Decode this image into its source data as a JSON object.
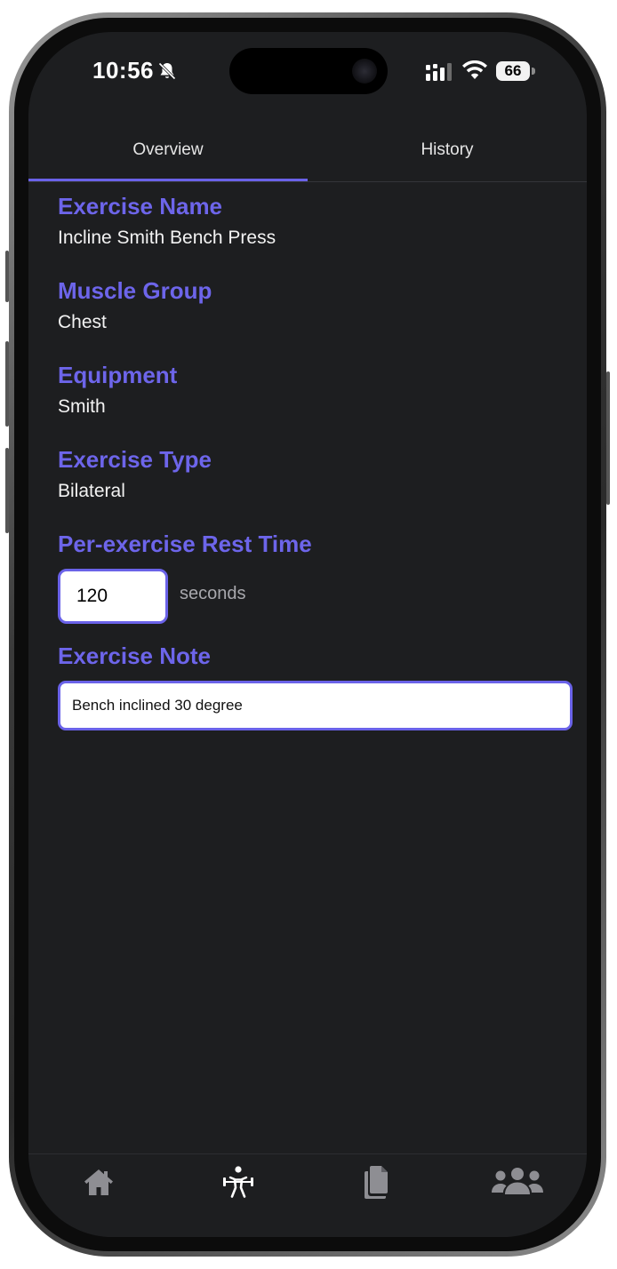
{
  "status_bar": {
    "time": "10:56",
    "battery_level": "66",
    "icons": [
      "bell-slash-icon",
      "signal-icon",
      "wifi-icon",
      "battery-icon"
    ]
  },
  "tabs": [
    {
      "label": "Overview",
      "active": true
    },
    {
      "label": "History",
      "active": false
    }
  ],
  "exercise": {
    "name_label": "Exercise Name",
    "name_value": "Incline Smith Bench Press",
    "muscle_label": "Muscle Group",
    "muscle_value": "Chest",
    "equipment_label": "Equipment",
    "equipment_value": "Smith",
    "type_label": "Exercise Type",
    "type_value": "Bilateral",
    "rest_label": "Per-exercise Rest Time",
    "rest_value": "120",
    "rest_unit": "seconds",
    "note_label": "Exercise Note",
    "note_value": "Bench inclined 30 degree"
  },
  "bottom_nav": [
    {
      "icon": "home-icon"
    },
    {
      "icon": "weightlifter-icon"
    },
    {
      "icon": "documents-icon"
    },
    {
      "icon": "users-icon"
    }
  ],
  "colors": {
    "accent": "#6a62e8",
    "background": "#1d1e20",
    "text": "#f2f2f2",
    "nav_icon": "#8e8e93"
  }
}
